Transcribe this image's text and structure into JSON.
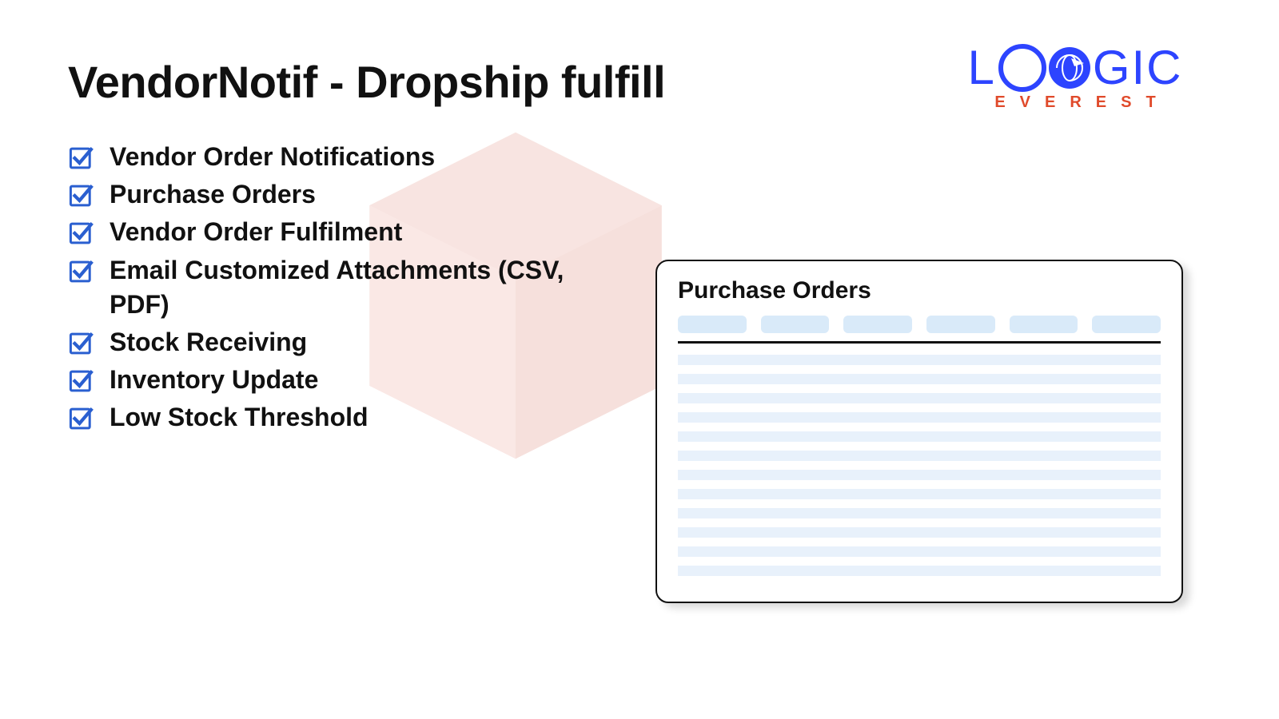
{
  "title": "VendorNotif - Dropship fulfill",
  "logo": {
    "main_left": "L",
    "main_right": "GIC",
    "sub": "EVEREST"
  },
  "features": [
    "Vendor Order Notifications",
    "Purchase Orders",
    "Vendor Order Fulfilment",
    "Email Customized Attachments (CSV, PDF)",
    "Stock Receiving",
    "Inventory Update",
    "Low Stock Threshold"
  ],
  "po_card": {
    "title": "Purchase Orders",
    "tab_count": 6,
    "line_count": 12
  },
  "colors": {
    "brand_blue": "#2d44ff",
    "brand_orange": "#e04a2b",
    "check_blue": "#2a5fd0",
    "po_tab": "#d9eaf9",
    "po_line": "#e8f1fb",
    "bg_box": "#f6d2cc"
  }
}
